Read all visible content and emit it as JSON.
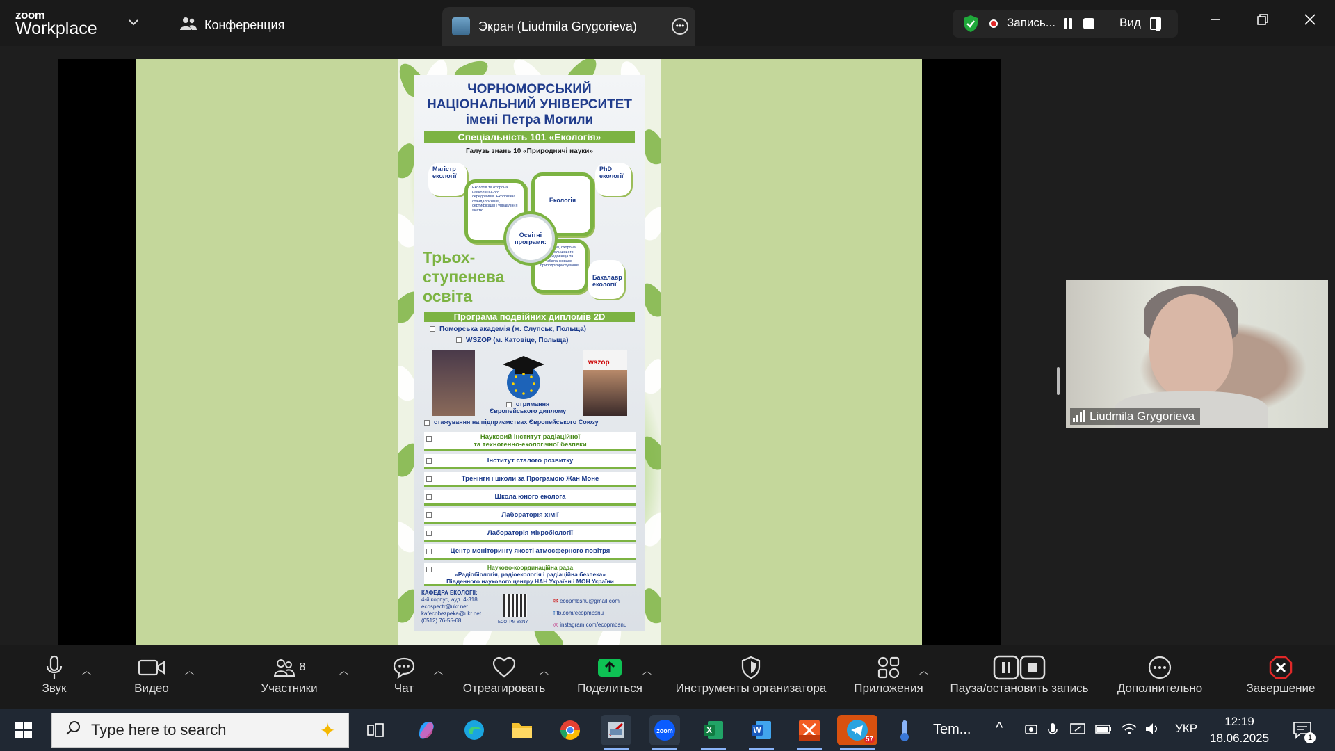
{
  "app": {
    "logo_line1": "zoom",
    "logo_line2": "Workplace"
  },
  "tabs": {
    "conference": "Конференция",
    "screen_share": "Экран (Liudmila Grygorieva)"
  },
  "recording": {
    "label": "Запись...",
    "view_label": "Вид",
    "accent_green": "#1fa83a",
    "dot_color": "#e02828"
  },
  "poster": {
    "title_line1": "ЧОРНОМОРСЬКИЙ",
    "title_line2": "НАЦІОНАЛЬНИЙ УНІВЕРСИТЕТ",
    "title_line3": "імені Петра Могили",
    "specialty": "Спеціальність 101 «Екологія»",
    "field": "Галузь знань 10 «Природничі науки»",
    "master": "Магістр екології",
    "phd": "PhD екології",
    "program_a": "Екологія та охорона навколишнього середовища. Екологічна стандартизація, сертифікація і управління якістю",
    "program_b": "Екологія",
    "program_c": "Екологія, охорона навколишнього середовища та збалансоване природокористування",
    "center": "Освітні програми:",
    "bachelor": "Бакалавр екології",
    "three_level_1": "Трьох-",
    "three_level_2": "ступенева",
    "three_level_3": "освіта",
    "double_diploma": "Програма подвійних дипломів 2D",
    "partner1": "Поморська академія (м. Слупськ, Польща)",
    "partner2": "WSZOP (м. Катовіце, Польща)",
    "european_diploma_1": "отримання",
    "european_diploma_2": "Європейського диплому",
    "wszop_logo": "wszop",
    "internship": "стажування на підприємствах Європейського Союзу",
    "institutes": [
      {
        "line1": "Науковий інститут радіаційної",
        "line2": "та техногенно-екологічної безпеки"
      },
      {
        "line1": "Інститут сталого розвитку",
        "line2": ""
      },
      {
        "line1": "Тренінги і школи за Програмою Жан Моне",
        "line2": ""
      },
      {
        "line1": "Школа юного еколога",
        "line2": ""
      },
      {
        "line1": "Лабораторія хімії",
        "line2": ""
      },
      {
        "line1": "Лабораторія мікробіології",
        "line2": ""
      },
      {
        "line1": "Центр моніторингу якості атмосферного повітря",
        "line2": ""
      }
    ],
    "council_1": "Науково-координаційна рада",
    "council_2": "«Радіобіологія, радіоекологія і радіаційна безпека»",
    "council_3": "Південного наукового центру НАН України і МОН України",
    "dept_1": "КАФЕДРА ЕКОЛОГІЇ:",
    "dept_2": "4-й корпус, ауд. 4-318",
    "dept_3": "ecospectr@ukr.net",
    "dept_4": "kafecobezpeka@ukr.net",
    "dept_5": "(0512) 76-55-68",
    "qr_caption": "ECO_PM BSNY",
    "email": "ecopmbsnu@gmail.com",
    "fb": "fb.com/ecopmbsnu",
    "insta": "instagram.com/ecopmbsnu",
    "green": "#7cb342",
    "blue": "#1b3a8a"
  },
  "participant": {
    "name": "Liudmila Grygorieva"
  },
  "toolbar": {
    "audio": "Звук",
    "video": "Видео",
    "participants": "Участники",
    "participants_count": "8",
    "chat": "Чат",
    "react": "Отреагировать",
    "share": "Поделиться",
    "host_tools": "Инструменты организатора",
    "apps": "Приложения",
    "pause_stop": "Пауза/остановить запись",
    "more": "Дополнительно",
    "end": "Завершение",
    "share_green": "#0ec254",
    "end_red": "#e02828"
  },
  "taskbar": {
    "search_placeholder": "Type here to search",
    "weather": "Tem...",
    "telegram_badge": "57",
    "language": "УКР",
    "time": "12:19",
    "date": "18.06.2025",
    "notifications": "1",
    "apps": [
      "task-view",
      "copilot",
      "edge",
      "file-explorer",
      "chrome",
      "unknown-app",
      "zoom",
      "excel",
      "word",
      "reader",
      "telegram"
    ]
  }
}
